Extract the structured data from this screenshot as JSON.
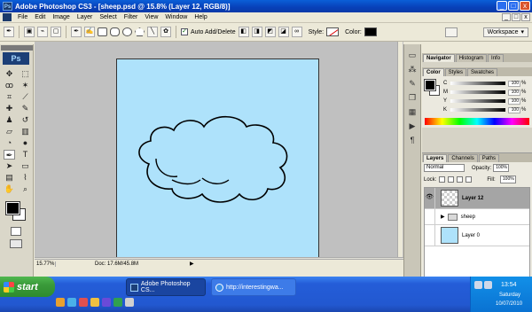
{
  "window": {
    "title": "Adobe Photoshop CS3 - [sheep.psd @ 15.8% (Layer 12, RGB/8)]",
    "app_badge": "Ps",
    "controls": [
      "_",
      "□",
      "x"
    ]
  },
  "menu": {
    "items": [
      "File",
      "Edit",
      "Image",
      "Layer",
      "Select",
      "Filter",
      "View",
      "Window",
      "Help"
    ],
    "doc_controls": [
      "_",
      "□",
      "x"
    ]
  },
  "options_bar": {
    "auto_add_delete_label": "Auto Add/Delete",
    "auto_add_delete_checked": true,
    "style_label": "Style:",
    "color_label": "Color:",
    "color_value": "#000000",
    "workspace_label": "Workspace",
    "workspace_arrow": "▾"
  },
  "toolbox": {
    "logo": "Ps",
    "tools": [
      {
        "name": "move-tool",
        "glyph": "✥"
      },
      {
        "name": "marquee-tool",
        "glyph": "⬚"
      },
      {
        "name": "lasso-tool",
        "glyph": "ꝏ"
      },
      {
        "name": "magic-wand-tool",
        "glyph": "✶"
      },
      {
        "name": "crop-tool",
        "glyph": "⌗"
      },
      {
        "name": "slice-tool",
        "glyph": "⟋"
      },
      {
        "name": "healing-brush-tool",
        "glyph": "✚"
      },
      {
        "name": "brush-tool",
        "glyph": "✎"
      },
      {
        "name": "clone-stamp-tool",
        "glyph": "♟"
      },
      {
        "name": "history-brush-tool",
        "glyph": "↺"
      },
      {
        "name": "eraser-tool",
        "glyph": "▱"
      },
      {
        "name": "gradient-tool",
        "glyph": "▥"
      },
      {
        "name": "blur-tool",
        "glyph": "◔"
      },
      {
        "name": "dodge-tool",
        "glyph": "●"
      },
      {
        "name": "pen-tool",
        "glyph": "✒"
      },
      {
        "name": "type-tool",
        "glyph": "T"
      },
      {
        "name": "path-selection-tool",
        "glyph": "➤"
      },
      {
        "name": "shape-tool",
        "glyph": "▭"
      },
      {
        "name": "notes-tool",
        "glyph": "▤"
      },
      {
        "name": "eyedropper-tool",
        "glyph": "⌇"
      },
      {
        "name": "hand-tool",
        "glyph": "✋"
      },
      {
        "name": "zoom-tool",
        "glyph": "⌕"
      }
    ],
    "active_tool": "pen-tool",
    "foreground_color": "#000000",
    "background_color": "#ffffff"
  },
  "canvas": {
    "background_color": "#aee2fb",
    "drawing": "cloud outline"
  },
  "status_bar": {
    "zoom": "15.77%",
    "doc_size": "Doc: 17.6M/45.8M",
    "arrow": "▶"
  },
  "panels": {
    "top_tabs": [
      "Navigator",
      "Histogram",
      "Info"
    ],
    "color_tabs": [
      "Color",
      "Styles",
      "Swatches"
    ],
    "cmyk": [
      {
        "label": "C",
        "value": "100",
        "unit": "%"
      },
      {
        "label": "M",
        "value": "100",
        "unit": "%"
      },
      {
        "label": "Y",
        "value": "100",
        "unit": "%"
      },
      {
        "label": "K",
        "value": "100",
        "unit": "%"
      }
    ],
    "layers_tabs": [
      "Layers",
      "Channels",
      "Paths"
    ],
    "blend_mode": "Normal",
    "opacity_label": "Opacity:",
    "opacity_value": "100%",
    "lock_label": "Lock:",
    "fill_label": "Fill:",
    "fill_value": "100%",
    "layers": [
      {
        "name": "Layer 12",
        "visible": true,
        "selected": true,
        "kind": "layer"
      },
      {
        "name": "sheep",
        "visible": false,
        "selected": false,
        "kind": "group"
      },
      {
        "name": "Layer 0",
        "visible": false,
        "selected": false,
        "kind": "layer"
      }
    ]
  },
  "taskbar": {
    "start_label": "start",
    "tasks": [
      {
        "label": "Adobe Photoshop CS...",
        "active": true
      },
      {
        "label": "http://interestingwa...",
        "active": false
      }
    ],
    "clock": {
      "time": "13:54",
      "day": "Saturday",
      "date": "10/07/2010"
    }
  }
}
